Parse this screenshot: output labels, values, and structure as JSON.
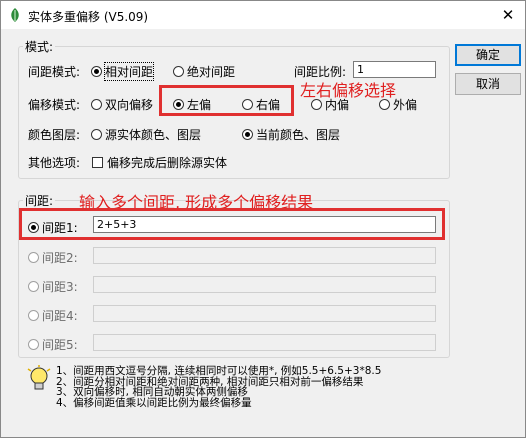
{
  "window": {
    "title": "实体多重偏移 (V5.09)",
    "close_glyph": "✕"
  },
  "mode_group": {
    "legend": "模式:",
    "spacing_mode_label": "间距模式:",
    "spacing_relative": "相对间距",
    "spacing_absolute": "绝对间距",
    "ratio_label": "间距比例:",
    "ratio_value": "1",
    "offset_mode_label": "偏移模式:",
    "offset_options": [
      "双向偏移",
      "左偏",
      "右偏",
      "内偏",
      "外偏"
    ],
    "color_layer_label": "颜色图层:",
    "color_source": "源实体颜色、图层",
    "color_current": "当前颜色、图层",
    "other_label": "其他选项:",
    "delete_source": "偏移完成后删除源实体"
  },
  "spacing_group": {
    "legend": "间距:",
    "rows": [
      {
        "label": "间距1:",
        "value": "2+5+3"
      },
      {
        "label": "间距2:",
        "value": ""
      },
      {
        "label": "间距3:",
        "value": ""
      },
      {
        "label": "间距4:",
        "value": ""
      },
      {
        "label": "间距5:",
        "value": ""
      }
    ]
  },
  "buttons": {
    "ok": "确定",
    "cancel": "取消"
  },
  "annotations": {
    "offset_note": "左右偏移选择",
    "spacing_note": "输入多个间距, 形成多个偏移结果"
  },
  "tips": [
    "1、间距用西文逗号分隔, 连续相同时可以使用*, 例如5.5+6.5+3*8.5",
    "2、间距分相对间距和绝对间距两种, 相对间距只相对前一偏移结果",
    "3、双向偏移时, 相同自动朝实体两侧偏移",
    "4、偏移间距值乘以间距比例为最终偏移量"
  ],
  "colors": {
    "annotation_red": "#e02020",
    "default_button_border": "#0078d7"
  }
}
